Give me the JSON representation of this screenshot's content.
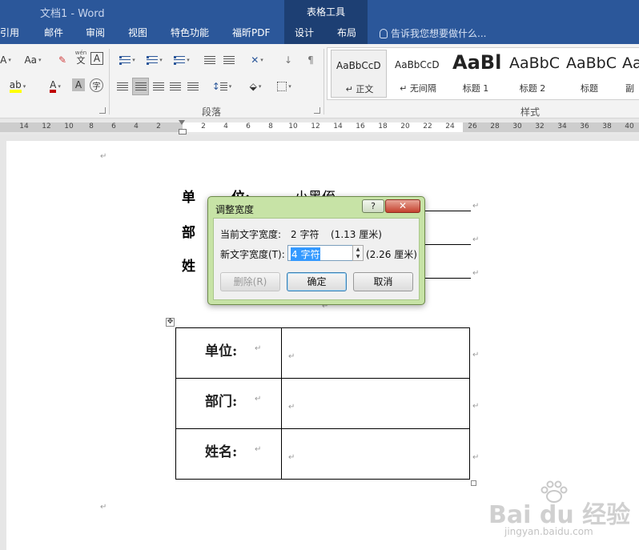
{
  "window": {
    "title": "文档1 - Word",
    "context_group": "表格工具",
    "tabs": [
      "引用",
      "邮件",
      "审阅",
      "视图",
      "特色功能",
      "福昕PDF",
      "设计",
      "布局"
    ],
    "tellme_placeholder": "告诉我您想要做什么..."
  },
  "ribbon": {
    "font_group": {
      "case_button": "Aa",
      "phonetic_glyph": "wén",
      "phonetic_char": "文",
      "border_char": "A",
      "highlight_char": "ab",
      "font_color_char": "A",
      "shade_char": "A",
      "enclose_char": "字"
    },
    "paragraph_group_label": "段落",
    "styles_group_label": "样式",
    "styles": [
      {
        "sample": "AaBbCcD",
        "name": "正文"
      },
      {
        "sample": "AaBbCcD",
        "name": "无间隔"
      },
      {
        "sample": "AaBl",
        "name": "标题 1"
      },
      {
        "sample": "AaBbC",
        "name": "标题 2"
      },
      {
        "sample": "AaBbC",
        "name": "标题"
      },
      {
        "sample": "Aa",
        "name": "副"
      }
    ],
    "accent_colors": {
      "highlight": "#ffff00",
      "font_color": "#c00000"
    }
  },
  "ruler": {
    "ticks": [
      "14",
      "12",
      "10",
      "8",
      "6",
      "4",
      "2",
      "2",
      "4",
      "6",
      "8",
      "10",
      "12",
      "14",
      "16",
      "18",
      "20",
      "22",
      "24",
      "26",
      "28",
      "30",
      "32",
      "34",
      "36",
      "38",
      "40"
    ]
  },
  "document": {
    "paragraph_mark": "↵",
    "form": {
      "row1_label_a": "单",
      "row1_label_b": "位:",
      "row1_value": "小黑侄",
      "row2_label": "部",
      "row3_label": "姓"
    },
    "table": {
      "rows": [
        {
          "label": "单位:"
        },
        {
          "label": "部门:"
        },
        {
          "label": "姓名:"
        }
      ]
    }
  },
  "dialog": {
    "title": "调整宽度",
    "help": "?",
    "close": "✕",
    "current_label": "当前文字宽度:",
    "current_value": "2 字符",
    "current_cm": "(1.13 厘米)",
    "new_label": "新文字宽度(T):",
    "new_value": "4 字符",
    "new_cm": "(2.26 厘米)",
    "delete_button": "删除(R)",
    "ok_button": "确定",
    "cancel_button": "取消"
  },
  "watermark": {
    "brand": "Bai du 经验",
    "url": "jingyan.baidu.com"
  }
}
